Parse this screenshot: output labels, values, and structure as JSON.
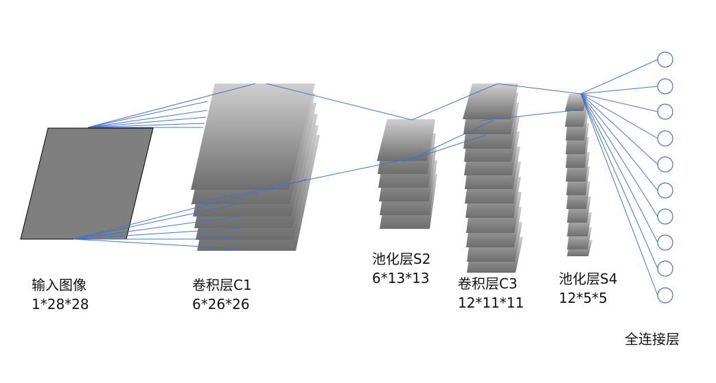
{
  "layers": {
    "input": {
      "name": "输入图像",
      "dims": "1*28*28"
    },
    "conv1": {
      "name": "卷积层C1",
      "dims": "6*26*26"
    },
    "pool2": {
      "name": "池化层S2",
      "dims": "6*13*13"
    },
    "conv3": {
      "name": "卷积层C3",
      "dims": "12*11*11"
    },
    "pool4": {
      "name": "池化层S4",
      "dims": "12*5*5"
    },
    "fc": {
      "name": "全连接层"
    }
  },
  "colors": {
    "connection": "#4472c4",
    "map_light": "#cfcfcf",
    "map_dark": "#6e6e6e",
    "input_fill": "#7f7f7f",
    "node_stroke": "#4472c4"
  },
  "counts": {
    "conv1_maps": 6,
    "pool2_maps": 6,
    "conv3_maps": 12,
    "pool4_maps": 12,
    "fc_nodes": 10
  }
}
